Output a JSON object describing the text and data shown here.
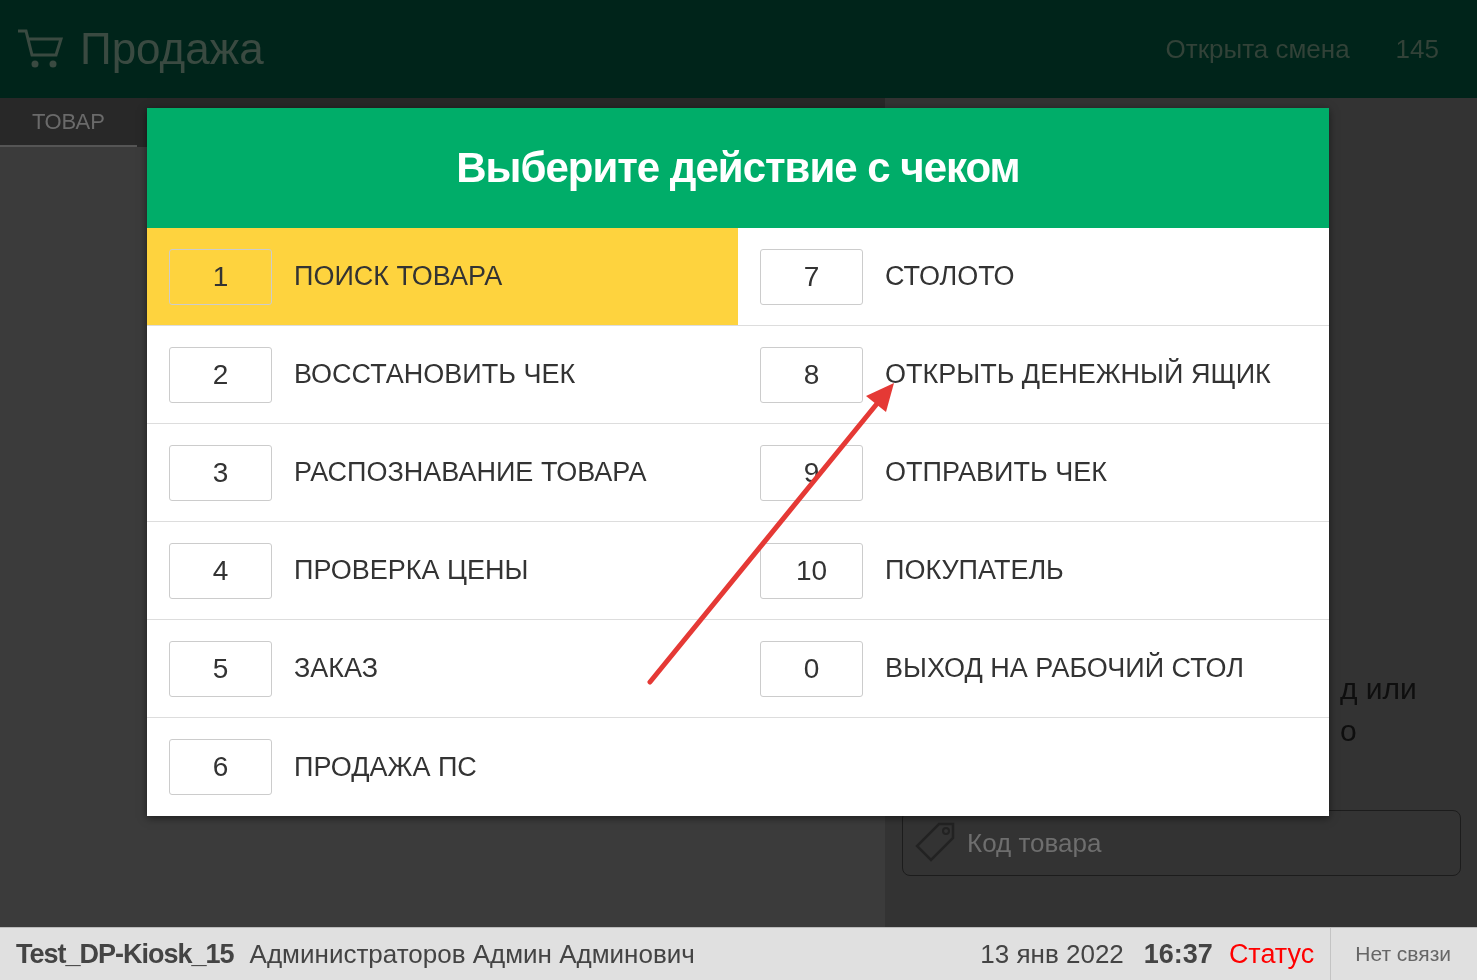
{
  "header": {
    "title": "Продажа",
    "shift_status": "Открыта смена",
    "shift_number": "145"
  },
  "tabs": [
    {
      "label": "ТОВАР",
      "selected": true
    }
  ],
  "right_panel": {
    "prompt_lines": [
      "д или",
      "о"
    ],
    "code_field": {
      "placeholder": "Код товара"
    }
  },
  "dialog": {
    "title": "Выберите действие с чеком",
    "actions": [
      {
        "key": "1",
        "label": "ПОИСК ТОВАРА",
        "selected": true
      },
      {
        "key": "2",
        "label": "ВОССТАНОВИТЬ ЧЕК",
        "selected": false
      },
      {
        "key": "3",
        "label": "РАСПОЗНАВАНИЕ ТОВАРА",
        "selected": false
      },
      {
        "key": "4",
        "label": "ПРОВЕРКА ЦЕНЫ",
        "selected": false
      },
      {
        "key": "5",
        "label": "ЗАКАЗ",
        "selected": false
      },
      {
        "key": "6",
        "label": "ПРОДАЖА ПС",
        "selected": false
      },
      {
        "key": "7",
        "label": "СТОЛОТО",
        "selected": false
      },
      {
        "key": "8",
        "label": "ОТКРЫТЬ ДЕНЕЖНЫЙ ЯЩИК",
        "selected": false
      },
      {
        "key": "9",
        "label": "ОТПРАВИТЬ ЧЕК",
        "selected": false
      },
      {
        "key": "10",
        "label": "ПОКУПАТЕЛЬ",
        "selected": false
      },
      {
        "key": "0",
        "label": "ВЫХОД НА РАБОЧИЙ СТОЛ",
        "selected": false
      }
    ]
  },
  "status_bar": {
    "terminal": "Test_DP-Kiosk_15",
    "user": "Администраторов Админ Админович",
    "date": "13 янв 2022",
    "time": "16:37",
    "status": "Статус",
    "connection": "Нет связи"
  }
}
